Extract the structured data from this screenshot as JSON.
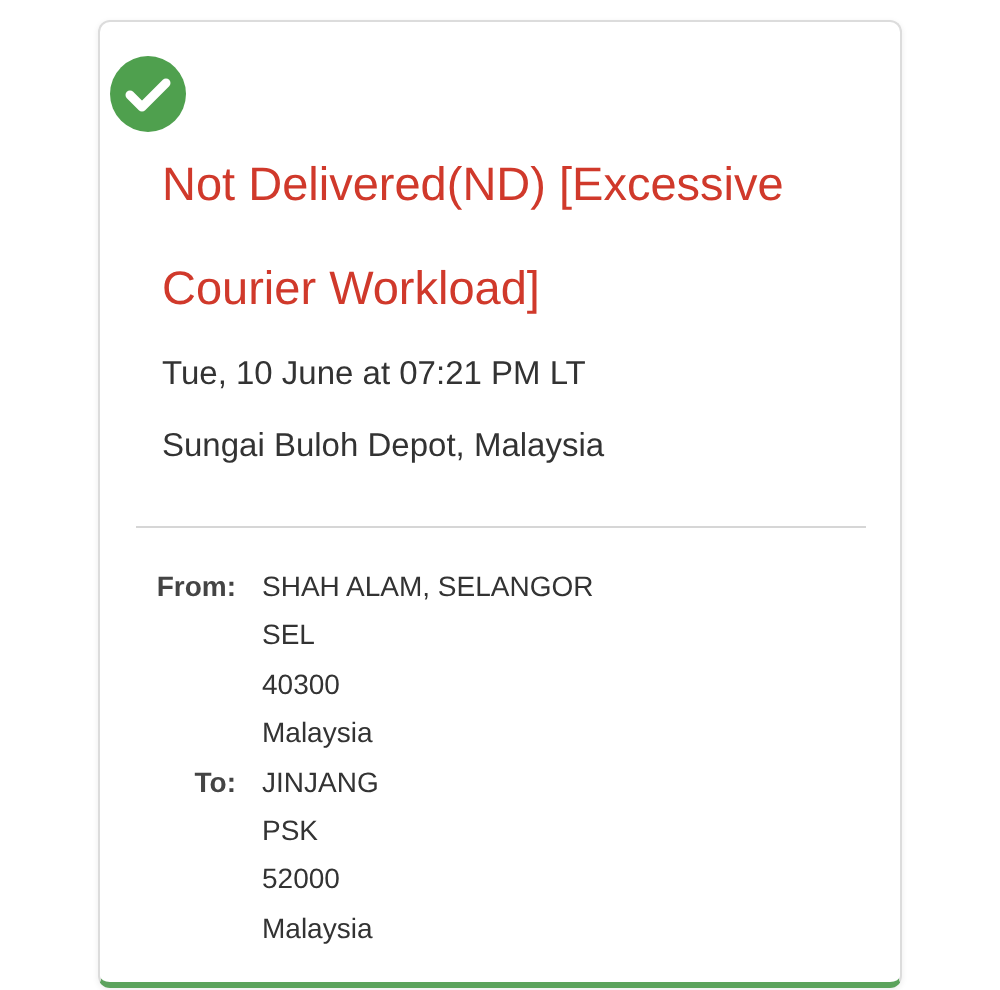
{
  "event": {
    "done": true,
    "title": "Not Delivered(ND) [Excessive Courier Workload]",
    "time": "Tue, 10 June at 07:21 PM LT",
    "location": "Sungai Buloh Depot, Malaysia"
  },
  "addresses": [
    {
      "label": "From:",
      "lines": [
        "SHAH ALAM, SELANGOR",
        "SEL",
        "40300",
        "Malaysia"
      ]
    },
    {
      "label": "To:",
      "lines": [
        "JINJANG",
        "PSK",
        "52000",
        "Malaysia"
      ]
    }
  ]
}
